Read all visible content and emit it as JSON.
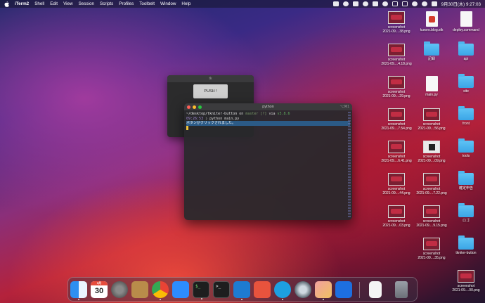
{
  "menubar": {
    "app_name": "iTerm2",
    "menus": [
      "Shell",
      "Edit",
      "View",
      "Session",
      "Scripts",
      "Profiles",
      "Toolbelt",
      "Window",
      "Help"
    ],
    "clock": "9月30日(木) 9:27:03"
  },
  "tk_window": {
    "title": "tk",
    "button_label": "PUSH !"
  },
  "terminal": {
    "title": "python",
    "shortcut": "⌥⌘1",
    "prompt_path": "~/desktop/tkniter-button",
    "prompt_on": "on",
    "prompt_branch": "master [?]",
    "prompt_via": "via",
    "prompt_version": "v3.8.6",
    "time": "09:26:53",
    "command": "python main.py",
    "output": "ボタンがクリックされました。"
  },
  "desktop_icons": [
    {
      "label1": "screenshot",
      "label2": "2021-09....38.png",
      "kind": "thumb"
    },
    {
      "label1": "kuroro.blog.stk",
      "label2": "",
      "kind": "doc"
    },
    {
      "label1": "deploy.command",
      "label2": "",
      "kind": "doc-plain"
    },
    {
      "label1": "screenshot",
      "label2": "2021-09....4.18.png",
      "kind": "thumb"
    },
    {
      "label1": "記録",
      "label2": "",
      "kind": "folder"
    },
    {
      "label1": "api",
      "label2": "",
      "kind": "folder"
    },
    {
      "label1": "screenshot",
      "label2": "2021-09....29.png",
      "kind": "thumb"
    },
    {
      "label1": "main.py",
      "label2": "",
      "kind": "doc-plain"
    },
    {
      "label1": "site",
      "label2": "",
      "kind": "folder"
    },
    {
      "label1": "screenshot",
      "label2": "2021-09....7.54.png",
      "kind": "thumb"
    },
    {
      "label1": "screenshot",
      "label2": "2021-09....56.png",
      "kind": "thumb"
    },
    {
      "label1": "front",
      "label2": "",
      "kind": "folder"
    },
    {
      "label1": "screenshot",
      "label2": "2021-09....6.41.png",
      "kind": "thumb"
    },
    {
      "label1": "screenshot",
      "label2": "2021-09....09.png",
      "kind": "thumb-light"
    },
    {
      "label1": "tools",
      "label2": "",
      "kind": "folder"
    },
    {
      "label1": "screenshot",
      "label2": "2021-09....44.png",
      "kind": "thumb"
    },
    {
      "label1": "screenshot",
      "label2": "2021-09....7.22.png",
      "kind": "thumb"
    },
    {
      "label1": "確定申告",
      "label2": "",
      "kind": "folder"
    },
    {
      "label1": "screenshot",
      "label2": "2021-09....03.png",
      "kind": "thumb"
    },
    {
      "label1": "screenshot",
      "label2": "2021-09....9.15.png",
      "kind": "thumb"
    },
    {
      "label1": "ロゴ",
      "label2": "",
      "kind": "folder"
    },
    {
      "label1": "screenshot",
      "label2": "2021-09....35.png",
      "kind": "thumb"
    },
    {
      "label1": "tkniter-button",
      "label2": "",
      "kind": "folder"
    },
    {
      "label1": "screenshot",
      "label2": "2021-09....00.png",
      "kind": "thumb"
    }
  ],
  "dock": {
    "calendar_month": "9月",
    "calendar_day": "30"
  },
  "colors": {
    "accent_blue": "#3aa5e6",
    "terminal_highlight": "#2b5a86",
    "cursor": "#f0c43c"
  }
}
